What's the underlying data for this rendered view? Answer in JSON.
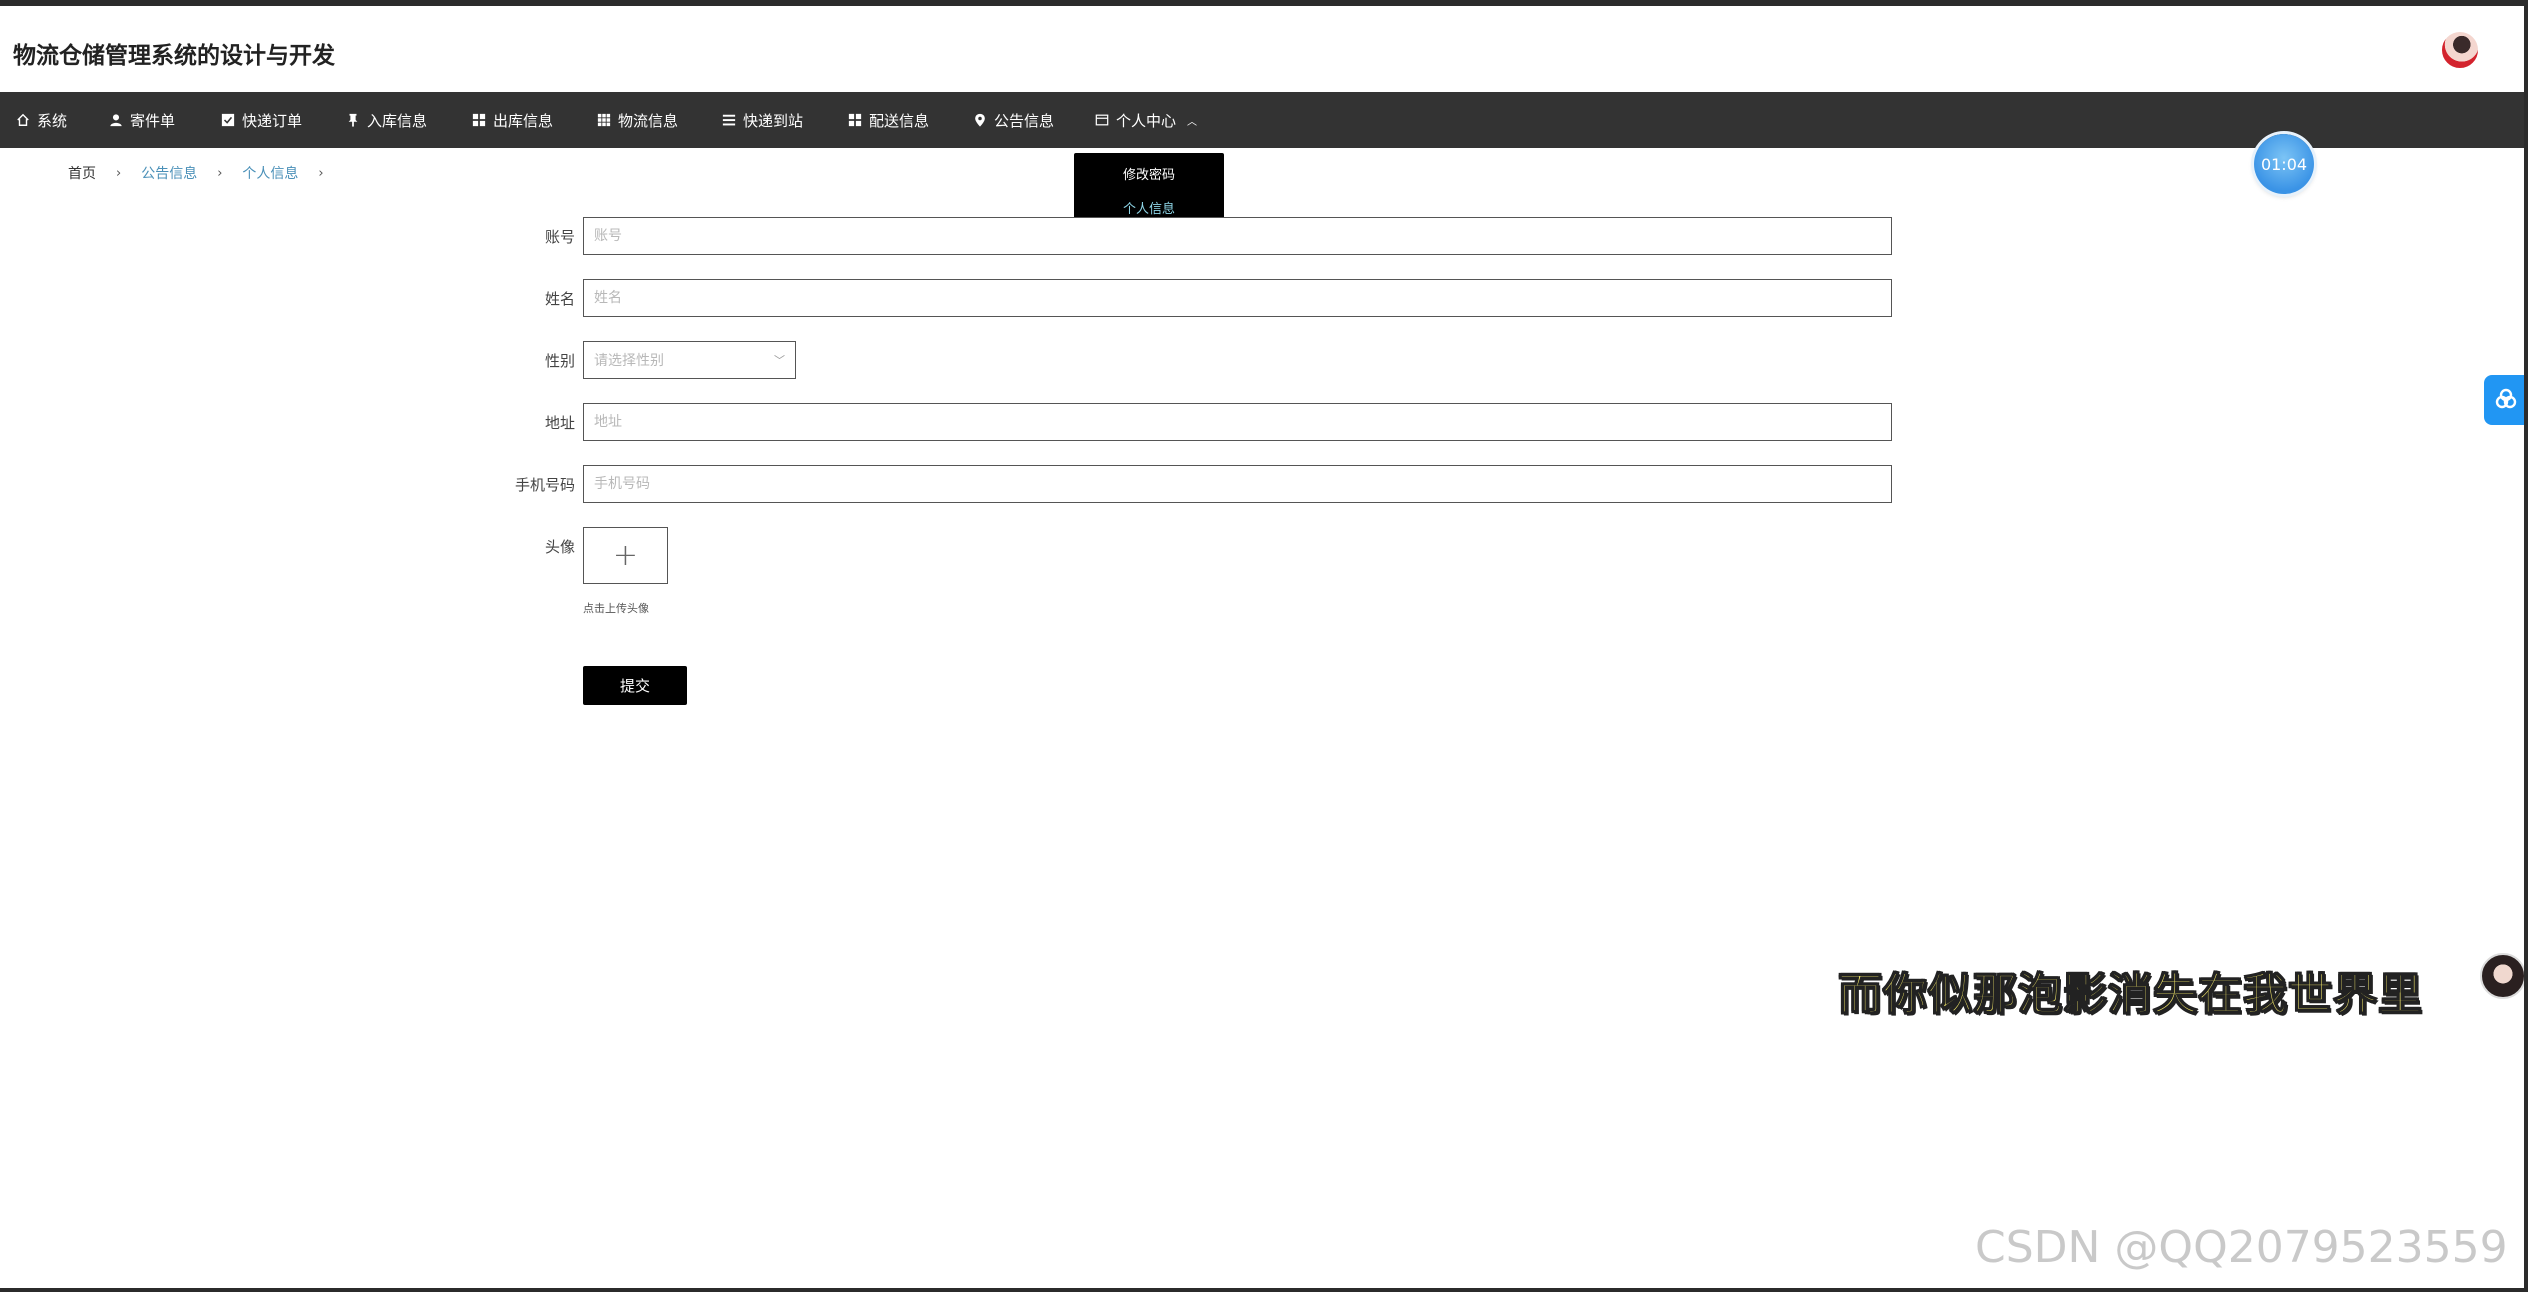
{
  "header": {
    "title": "物流仓储管理系统的设计与开发"
  },
  "nav": [
    {
      "label": "系统",
      "icon": "home-icon"
    },
    {
      "label": "寄件单",
      "icon": "user-icon"
    },
    {
      "label": "快递订单",
      "icon": "checkbox-icon"
    },
    {
      "label": "入库信息",
      "icon": "thumbtack-icon"
    },
    {
      "label": "出库信息",
      "icon": "grid-icon"
    },
    {
      "label": "物流信息",
      "icon": "apps-icon"
    },
    {
      "label": "快递到站",
      "icon": "list-icon"
    },
    {
      "label": "配送信息",
      "icon": "grid-icon"
    },
    {
      "label": "公告信息",
      "icon": "location-icon"
    },
    {
      "label": "个人中心",
      "icon": "window-icon"
    }
  ],
  "dropdown": {
    "items": [
      "修改密码",
      "个人信息"
    ],
    "active_index": 1
  },
  "breadcrumb": {
    "items": [
      "首页",
      "公告信息",
      "个人信息"
    ],
    "separator": "›"
  },
  "timer": "01:04",
  "form": {
    "account": {
      "label": "账号",
      "placeholder": "账号",
      "value": ""
    },
    "name": {
      "label": "姓名",
      "placeholder": "姓名",
      "value": ""
    },
    "gender": {
      "label": "性别",
      "placeholder": "请选择性别"
    },
    "address": {
      "label": "地址",
      "placeholder": "地址",
      "value": ""
    },
    "phone": {
      "label": "手机号码",
      "placeholder": "手机号码",
      "value": ""
    },
    "avatar": {
      "label": "头像",
      "hint": "点击上传头像"
    },
    "submit": "提交"
  },
  "overlay": {
    "lyric": "而你似那泡影消失在我世界里",
    "watermark": "CSDN @QQ2079523559"
  },
  "colors": {
    "navbar": "#333333",
    "dropdown": "#000000",
    "active_link": "#4a90b8",
    "float_button": "#2196f3"
  }
}
